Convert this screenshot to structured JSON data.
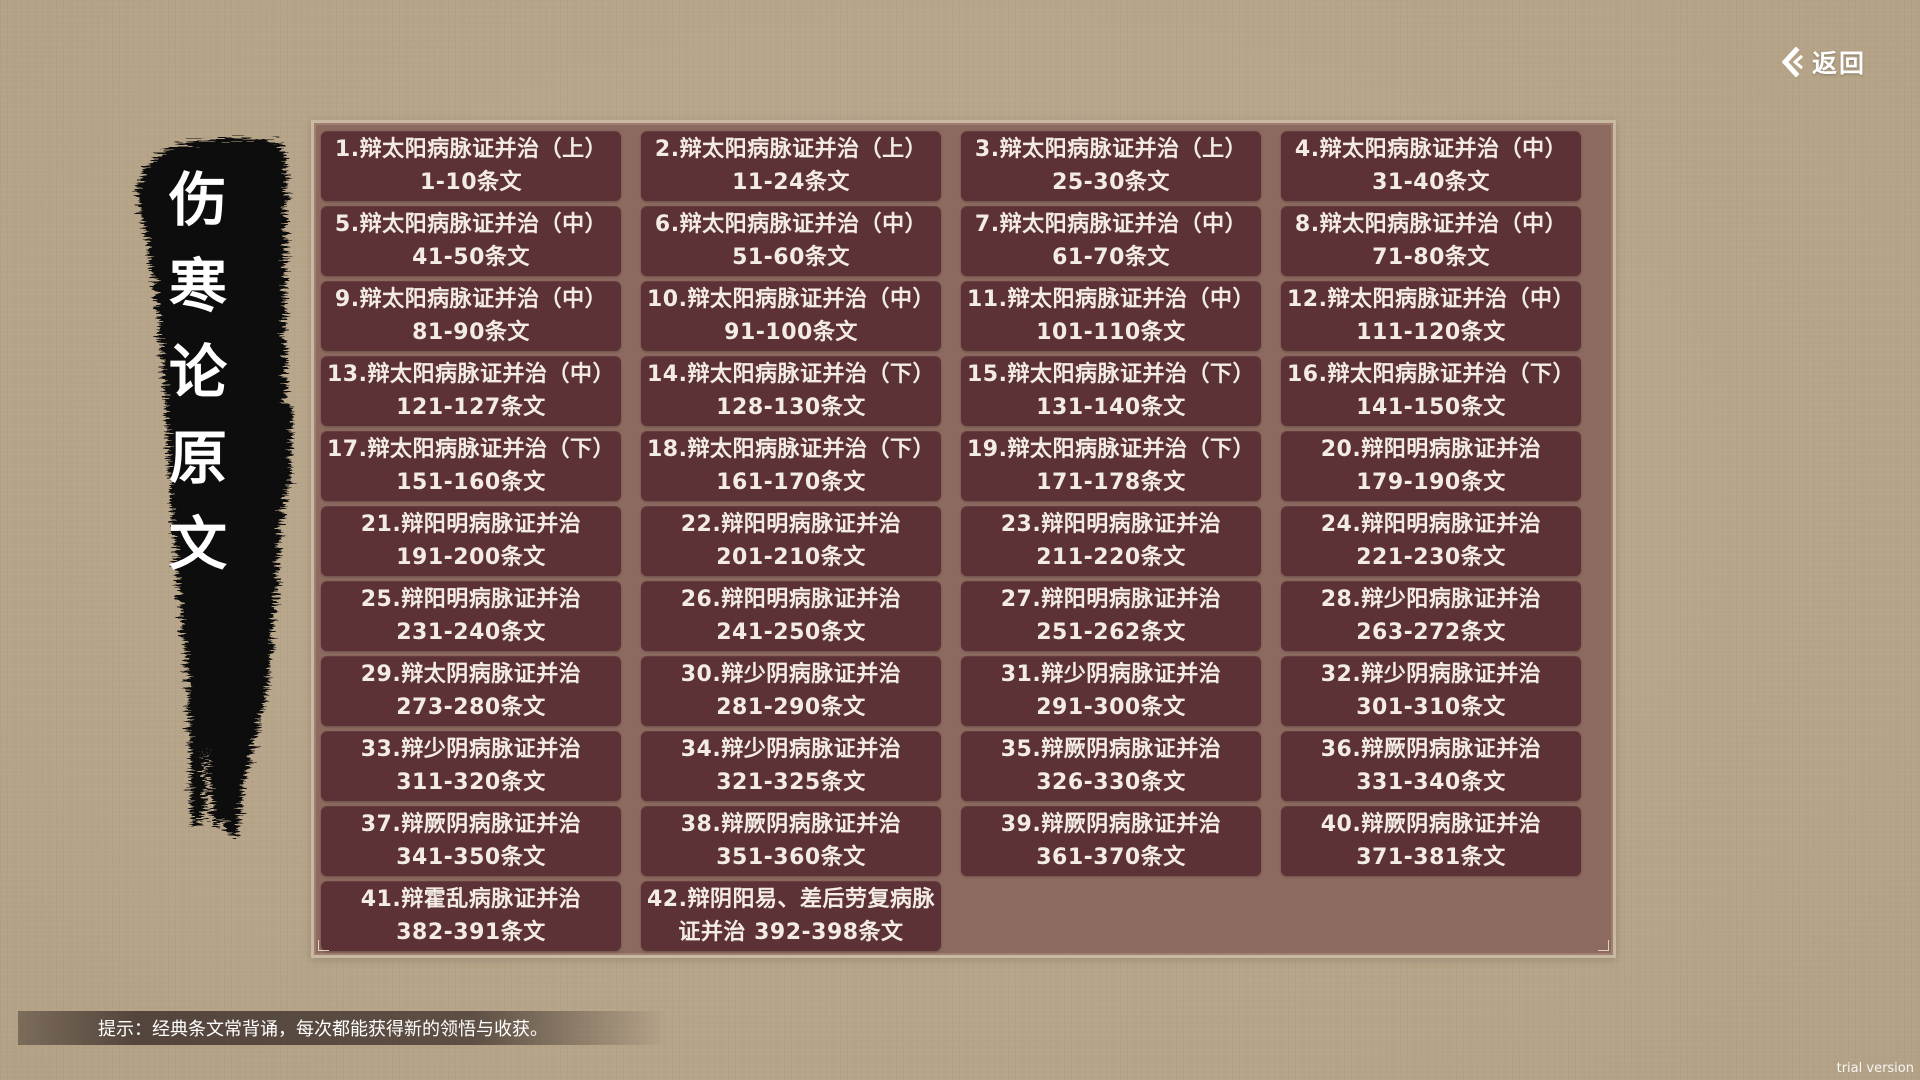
{
  "back": {
    "label": "返回",
    "icon": "back-arrow-icon"
  },
  "title": {
    "chars": [
      "伤",
      "寒",
      "论",
      "原",
      "文"
    ]
  },
  "chapters": [
    {
      "line1": "1.辩太阳病脉证并治（上）",
      "line2": "1-10条文"
    },
    {
      "line1": "2.辩太阳病脉证并治（上）",
      "line2": "11-24条文"
    },
    {
      "line1": "3.辩太阳病脉证并治（上）",
      "line2": "25-30条文"
    },
    {
      "line1": "4.辩太阳病脉证并治（中）",
      "line2": "31-40条文"
    },
    {
      "line1": "5.辩太阳病脉证并治（中）",
      "line2": "41-50条文"
    },
    {
      "line1": "6.辩太阳病脉证并治（中）",
      "line2": "51-60条文"
    },
    {
      "line1": "7.辩太阳病脉证并治（中）",
      "line2": "61-70条文"
    },
    {
      "line1": "8.辩太阳病脉证并治（中）",
      "line2": "71-80条文"
    },
    {
      "line1": "9.辩太阳病脉证并治（中）",
      "line2": "81-90条文"
    },
    {
      "line1": "10.辩太阳病脉证并治（中）",
      "line2": "91-100条文"
    },
    {
      "line1": "11.辩太阳病脉证并治（中）",
      "line2": "101-110条文"
    },
    {
      "line1": "12.辩太阳病脉证并治（中）",
      "line2": "111-120条文"
    },
    {
      "line1": "13.辩太阳病脉证并治（中）",
      "line2": "121-127条文"
    },
    {
      "line1": "14.辩太阳病脉证并治（下）",
      "line2": "128-130条文"
    },
    {
      "line1": "15.辩太阳病脉证并治（下）",
      "line2": "131-140条文"
    },
    {
      "line1": "16.辩太阳病脉证并治（下）",
      "line2": "141-150条文"
    },
    {
      "line1": "17.辩太阳病脉证并治（下）",
      "line2": "151-160条文"
    },
    {
      "line1": "18.辩太阳病脉证并治（下）",
      "line2": "161-170条文"
    },
    {
      "line1": "19.辩太阳病脉证并治（下）",
      "line2": "171-178条文"
    },
    {
      "line1": "20.辩阳明病脉证并治",
      "line2": "179-190条文"
    },
    {
      "line1": "21.辩阳明病脉证并治",
      "line2": "191-200条文"
    },
    {
      "line1": "22.辩阳明病脉证并治",
      "line2": "201-210条文"
    },
    {
      "line1": "23.辩阳明病脉证并治",
      "line2": "211-220条文"
    },
    {
      "line1": "24.辩阳明病脉证并治",
      "line2": "221-230条文"
    },
    {
      "line1": "25.辩阳明病脉证并治",
      "line2": "231-240条文"
    },
    {
      "line1": "26.辩阳明病脉证并治",
      "line2": "241-250条文"
    },
    {
      "line1": "27.辩阳明病脉证并治",
      "line2": "251-262条文"
    },
    {
      "line1": "28.辩少阳病脉证并治",
      "line2": "263-272条文"
    },
    {
      "line1": "29.辩太阴病脉证并治",
      "line2": "273-280条文"
    },
    {
      "line1": "30.辩少阴病脉证并治",
      "line2": "281-290条文"
    },
    {
      "line1": "31.辩少阴病脉证并治",
      "line2": "291-300条文"
    },
    {
      "line1": "32.辩少阴病脉证并治",
      "line2": "301-310条文"
    },
    {
      "line1": "33.辩少阴病脉证并治",
      "line2": "311-320条文"
    },
    {
      "line1": "34.辩少阴病脉证并治",
      "line2": "321-325条文"
    },
    {
      "line1": "35.辩厥阴病脉证并治",
      "line2": "326-330条文"
    },
    {
      "line1": "36.辩厥阴病脉证并治",
      "line2": "331-340条文"
    },
    {
      "line1": "37.辩厥阴病脉证并治",
      "line2": "341-350条文"
    },
    {
      "line1": "38.辩厥阴病脉证并治",
      "line2": "351-360条文"
    },
    {
      "line1": "39.辩厥阴病脉证并治",
      "line2": "361-370条文"
    },
    {
      "line1": "40.辩厥阴病脉证并治",
      "line2": "371-381条文"
    },
    {
      "line1": "41.辩霍乱病脉证并治",
      "line2": "382-391条文"
    },
    {
      "line1": "42.辩阴阳易、差后劳复病脉",
      "line2": "证并治 392-398条文"
    }
  ],
  "hint": {
    "text": "提示：经典条文常背诵，每次都能获得新的领悟与收获。"
  },
  "watermark": {
    "text": "trial version"
  },
  "colors": {
    "background": "#b7a68c",
    "panel": "#8d6a5f",
    "cell": "#5d3236",
    "cell_text": "#f3ece4",
    "ink": "#0c0c0c"
  }
}
